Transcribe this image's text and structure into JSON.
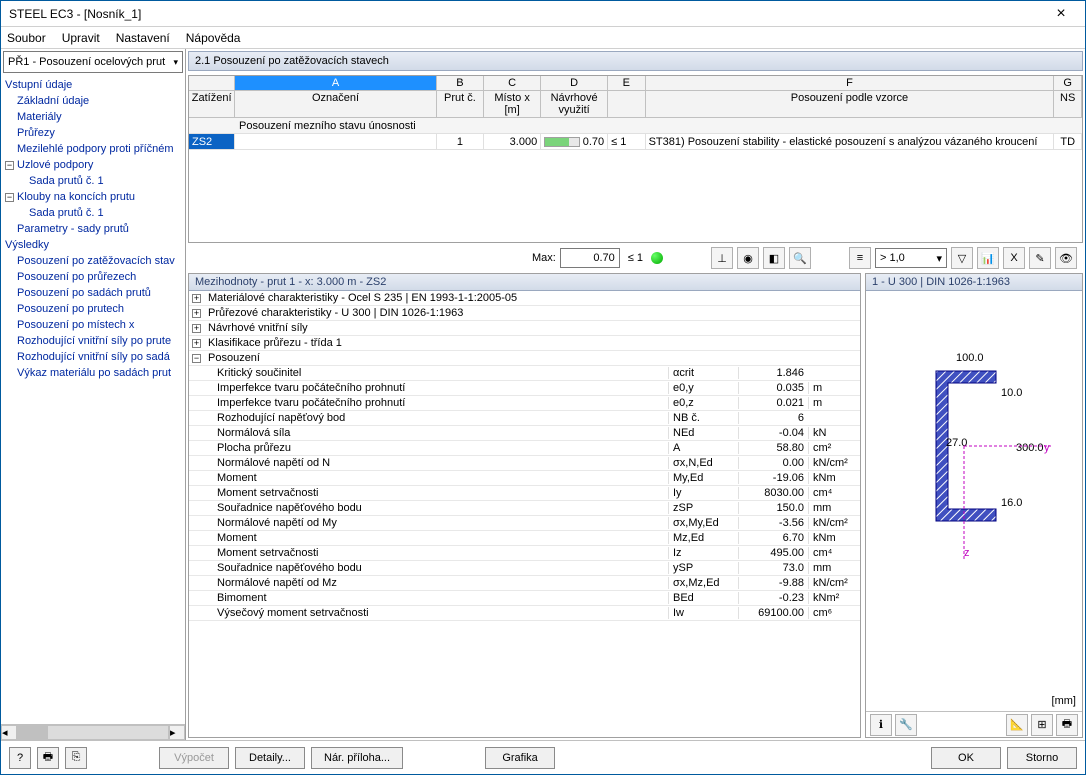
{
  "window": {
    "title": "STEEL EC3 - [Nosník_1]"
  },
  "menu": {
    "items": [
      "Soubor",
      "Upravit",
      "Nastavení",
      "Nápověda"
    ]
  },
  "combo": {
    "text": "PŘ1 - Posouzení ocelových prut"
  },
  "tree": {
    "g1": "Vstupní údaje",
    "items1": [
      "Základní údaje",
      "Materiály",
      "Průřezy",
      "Mezilehlé podpory proti příčném"
    ],
    "uzlove": "Uzlové podpory",
    "sada1": "Sada prutů č. 1",
    "klouby": "Klouby na koncích prutu",
    "sada2": "Sada prutů č. 1",
    "param": "Parametry - sady prutů",
    "g2": "Výsledky",
    "items2": [
      "Posouzení po zatěžovacích stav",
      "Posouzení po průřezech",
      "Posouzení po sadách prutů",
      "Posouzení po prutech",
      "Posouzení po místech x",
      "Rozhodující vnitřní síly po prute",
      "Rozhodující vnitřní síly po sadá",
      "Výkaz materiálu po sadách prut"
    ]
  },
  "section": {
    "title": "2.1 Posouzení po zatěžovacích stavech"
  },
  "grid": {
    "cols_top": [
      "",
      "A",
      "B",
      "C",
      "D",
      "E",
      "F",
      "G"
    ],
    "cols_bot": [
      "Zatížení",
      "Označení",
      "Prut č.",
      "Místo x [m]",
      "Návrhové využití",
      "",
      "Posouzení podle vzorce",
      "NS"
    ],
    "subheader": "Posouzení mezního stavu únosnosti",
    "row": {
      "z": "ZS2",
      "a": "",
      "b": "1",
      "c": "3.000",
      "d": "0.70",
      "e": "≤ 1",
      "f": "ST381) Posouzení stability - elastické posouzení s analýzou vázaného kroucení",
      "g": "TD"
    }
  },
  "tb": {
    "max": "Max:",
    "maxval": "0.70",
    "le1": "≤ 1",
    "combo": "> 1,0"
  },
  "detail": {
    "title": "Mezihodnoty - prut 1 - x: 3.000 m - ZS2",
    "groups": [
      "Materiálové charakteristiky - Ocel S 235 | EN 1993-1-1:2005-05",
      "Průřezové charakteristiky  -  U 300 | DIN 1026-1:1963",
      "Návrhové vnitřní síly",
      "Klasifikace průřezu - třída 1",
      "Posouzení"
    ],
    "rows": [
      {
        "l": "Kritický součinitel",
        "s": "αcrit",
        "v": "1.846",
        "u": ""
      },
      {
        "l": "Imperfekce tvaru počátečního prohnutí",
        "s": "e0,y",
        "v": "0.035",
        "u": "m"
      },
      {
        "l": "Imperfekce tvaru počátečního prohnutí",
        "s": "e0,z",
        "v": "0.021",
        "u": "m"
      },
      {
        "l": "Rozhodující napěťový bod",
        "s": "NB č.",
        "v": "6",
        "u": ""
      },
      {
        "l": "Normálová síla",
        "s": "NEd",
        "v": "-0.04",
        "u": "kN"
      },
      {
        "l": "Plocha průřezu",
        "s": "A",
        "v": "58.80",
        "u": "cm²"
      },
      {
        "l": "Normálové napětí od N",
        "s": "σx,N,Ed",
        "v": "0.00",
        "u": "kN/cm²"
      },
      {
        "l": "Moment",
        "s": "My,Ed",
        "v": "-19.06",
        "u": "kNm"
      },
      {
        "l": "Moment setrvačnosti",
        "s": "Iy",
        "v": "8030.00",
        "u": "cm⁴"
      },
      {
        "l": "Souřadnice napěťového bodu",
        "s": "zSP",
        "v": "150.0",
        "u": "mm"
      },
      {
        "l": "Normálové napětí od My",
        "s": "σx,My,Ed",
        "v": "-3.56",
        "u": "kN/cm²"
      },
      {
        "l": "Moment",
        "s": "Mz,Ed",
        "v": "6.70",
        "u": "kNm"
      },
      {
        "l": "Moment setrvačnosti",
        "s": "Iz",
        "v": "495.00",
        "u": "cm⁴"
      },
      {
        "l": "Souřadnice napěťového bodu",
        "s": "ySP",
        "v": "73.0",
        "u": "mm"
      },
      {
        "l": "Normálové napětí od Mz",
        "s": "σx,Mz,Ed",
        "v": "-9.88",
        "u": "kN/cm²"
      },
      {
        "l": "Bimoment",
        "s": "BEd",
        "v": "-0.23",
        "u": "kNm²"
      },
      {
        "l": "Výsečový moment setrvačnosti",
        "s": "Iw",
        "v": "69100.00",
        "u": "cm⁶"
      }
    ]
  },
  "preview": {
    "title": "1 - U 300 | DIN 1026-1:1963",
    "dims": {
      "w": "100.0",
      "h": "300.0",
      "tf": "16.0",
      "tw": "10.0",
      "e": "27.0"
    },
    "unit": "[mm]"
  },
  "buttons": {
    "vypocet": "Výpočet",
    "detaily": "Detaily...",
    "priloha": "Nár. příloha...",
    "grafika": "Grafika",
    "ok": "OK",
    "storno": "Storno"
  }
}
